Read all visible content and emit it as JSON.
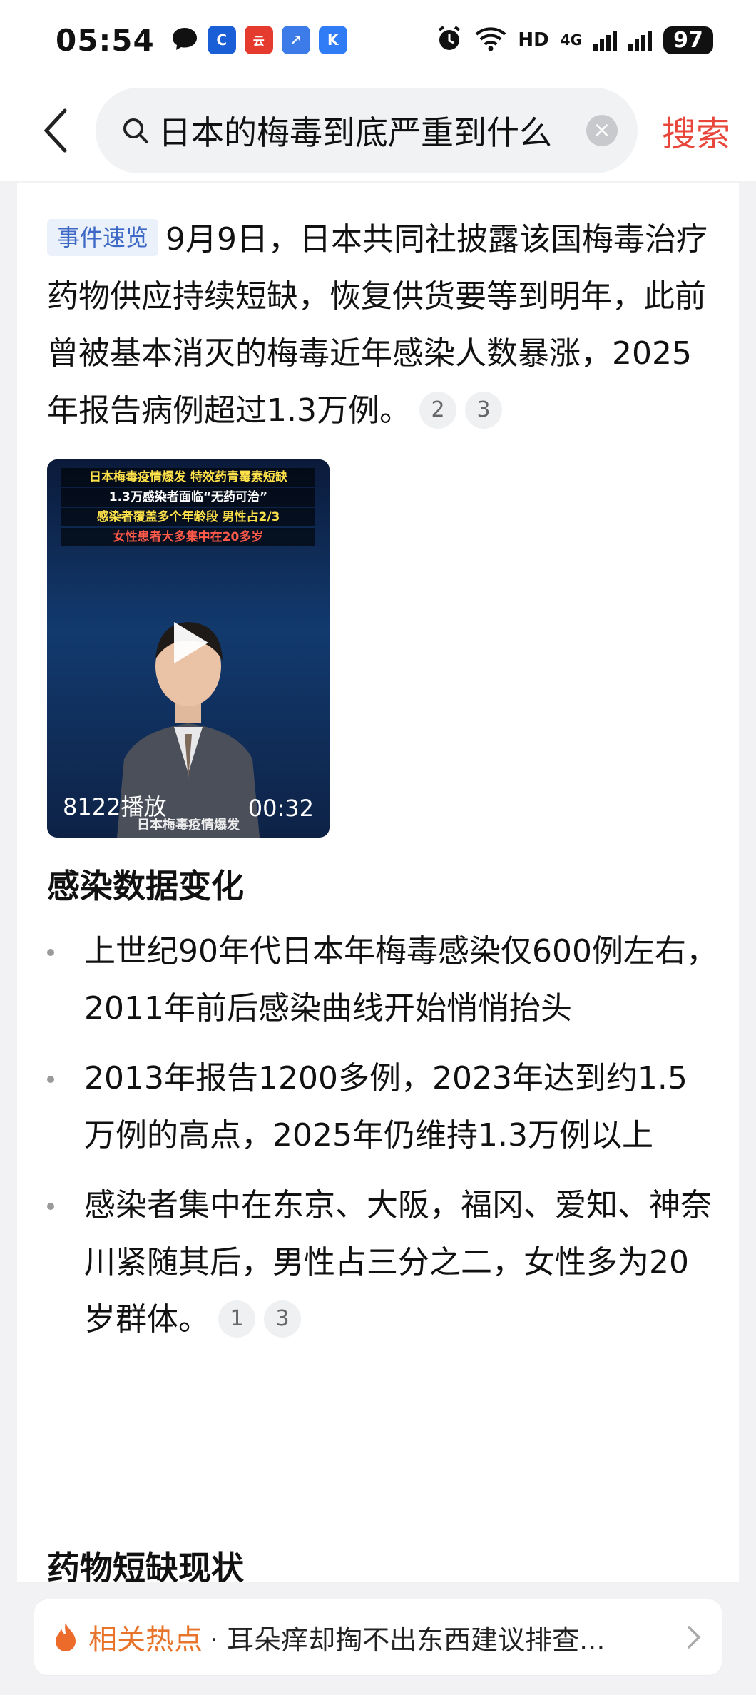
{
  "status_bar": {
    "time": "05:54",
    "network_label": "HD",
    "network_gen": "4G",
    "battery": "97",
    "app_icons": [
      {
        "name": "chat-bubble-icon",
        "color": "#111111",
        "glyph": ""
      },
      {
        "name": "blue-c-app-icon",
        "color": "#1a5fd6",
        "glyph": "C"
      },
      {
        "name": "cloud-pay-app-icon",
        "color": "#e53b2f",
        "glyph": "云"
      },
      {
        "name": "chart-app-icon",
        "color": "#3d7be8",
        "glyph": "↗"
      },
      {
        "name": "k-app-icon",
        "color": "#2f7cf6",
        "glyph": "K"
      }
    ]
  },
  "header": {
    "search_query": "日本的梅毒到底严重到什么",
    "search_button": "搜索"
  },
  "summary": {
    "tag": "事件速览",
    "text": "9月9日，日本共同社披露该国梅毒治疗药物供应持续短缺，恢复供货要等到明年，此前曾被基本消灭的梅毒近年感染人数暴涨，2025年报告病例超过1.3万例。",
    "citations": [
      "2",
      "3"
    ]
  },
  "video": {
    "banner": [
      "日本梅毒疫情爆发 特效药青霉素短缺",
      "1.3万感染者面临“无药可治”",
      "感染者覆盖多个年龄段 男性占2/3",
      "女性患者大多集中在20多岁"
    ],
    "plays": "8122播放",
    "duration": "00:32",
    "caption": "日本梅毒疫情爆发"
  },
  "section1": {
    "title": "感染数据变化",
    "bullets": [
      "上世纪90年代日本年梅毒感染仅600例左右，2011年前后感染曲线开始悄悄抬头",
      "2013年报告1200多例，2023年达到约1.5万例的高点，2025年仍维持1.3万例以上",
      "感染者集中在东京、大阪，福冈、爱知、神奈川紧随其后，男性占三分之二，女性多为20岁群体。"
    ],
    "bullet3_citations": [
      "1",
      "3"
    ]
  },
  "section2": {
    "title": "药物短缺现状"
  },
  "related": {
    "label": "相关热点",
    "text": "· 耳朵痒却掏不出东西建议排查..."
  },
  "colors": {
    "accent_red": "#e8463a",
    "tag_blue": "#3e68c5",
    "hot_orange": "#e8742c"
  }
}
